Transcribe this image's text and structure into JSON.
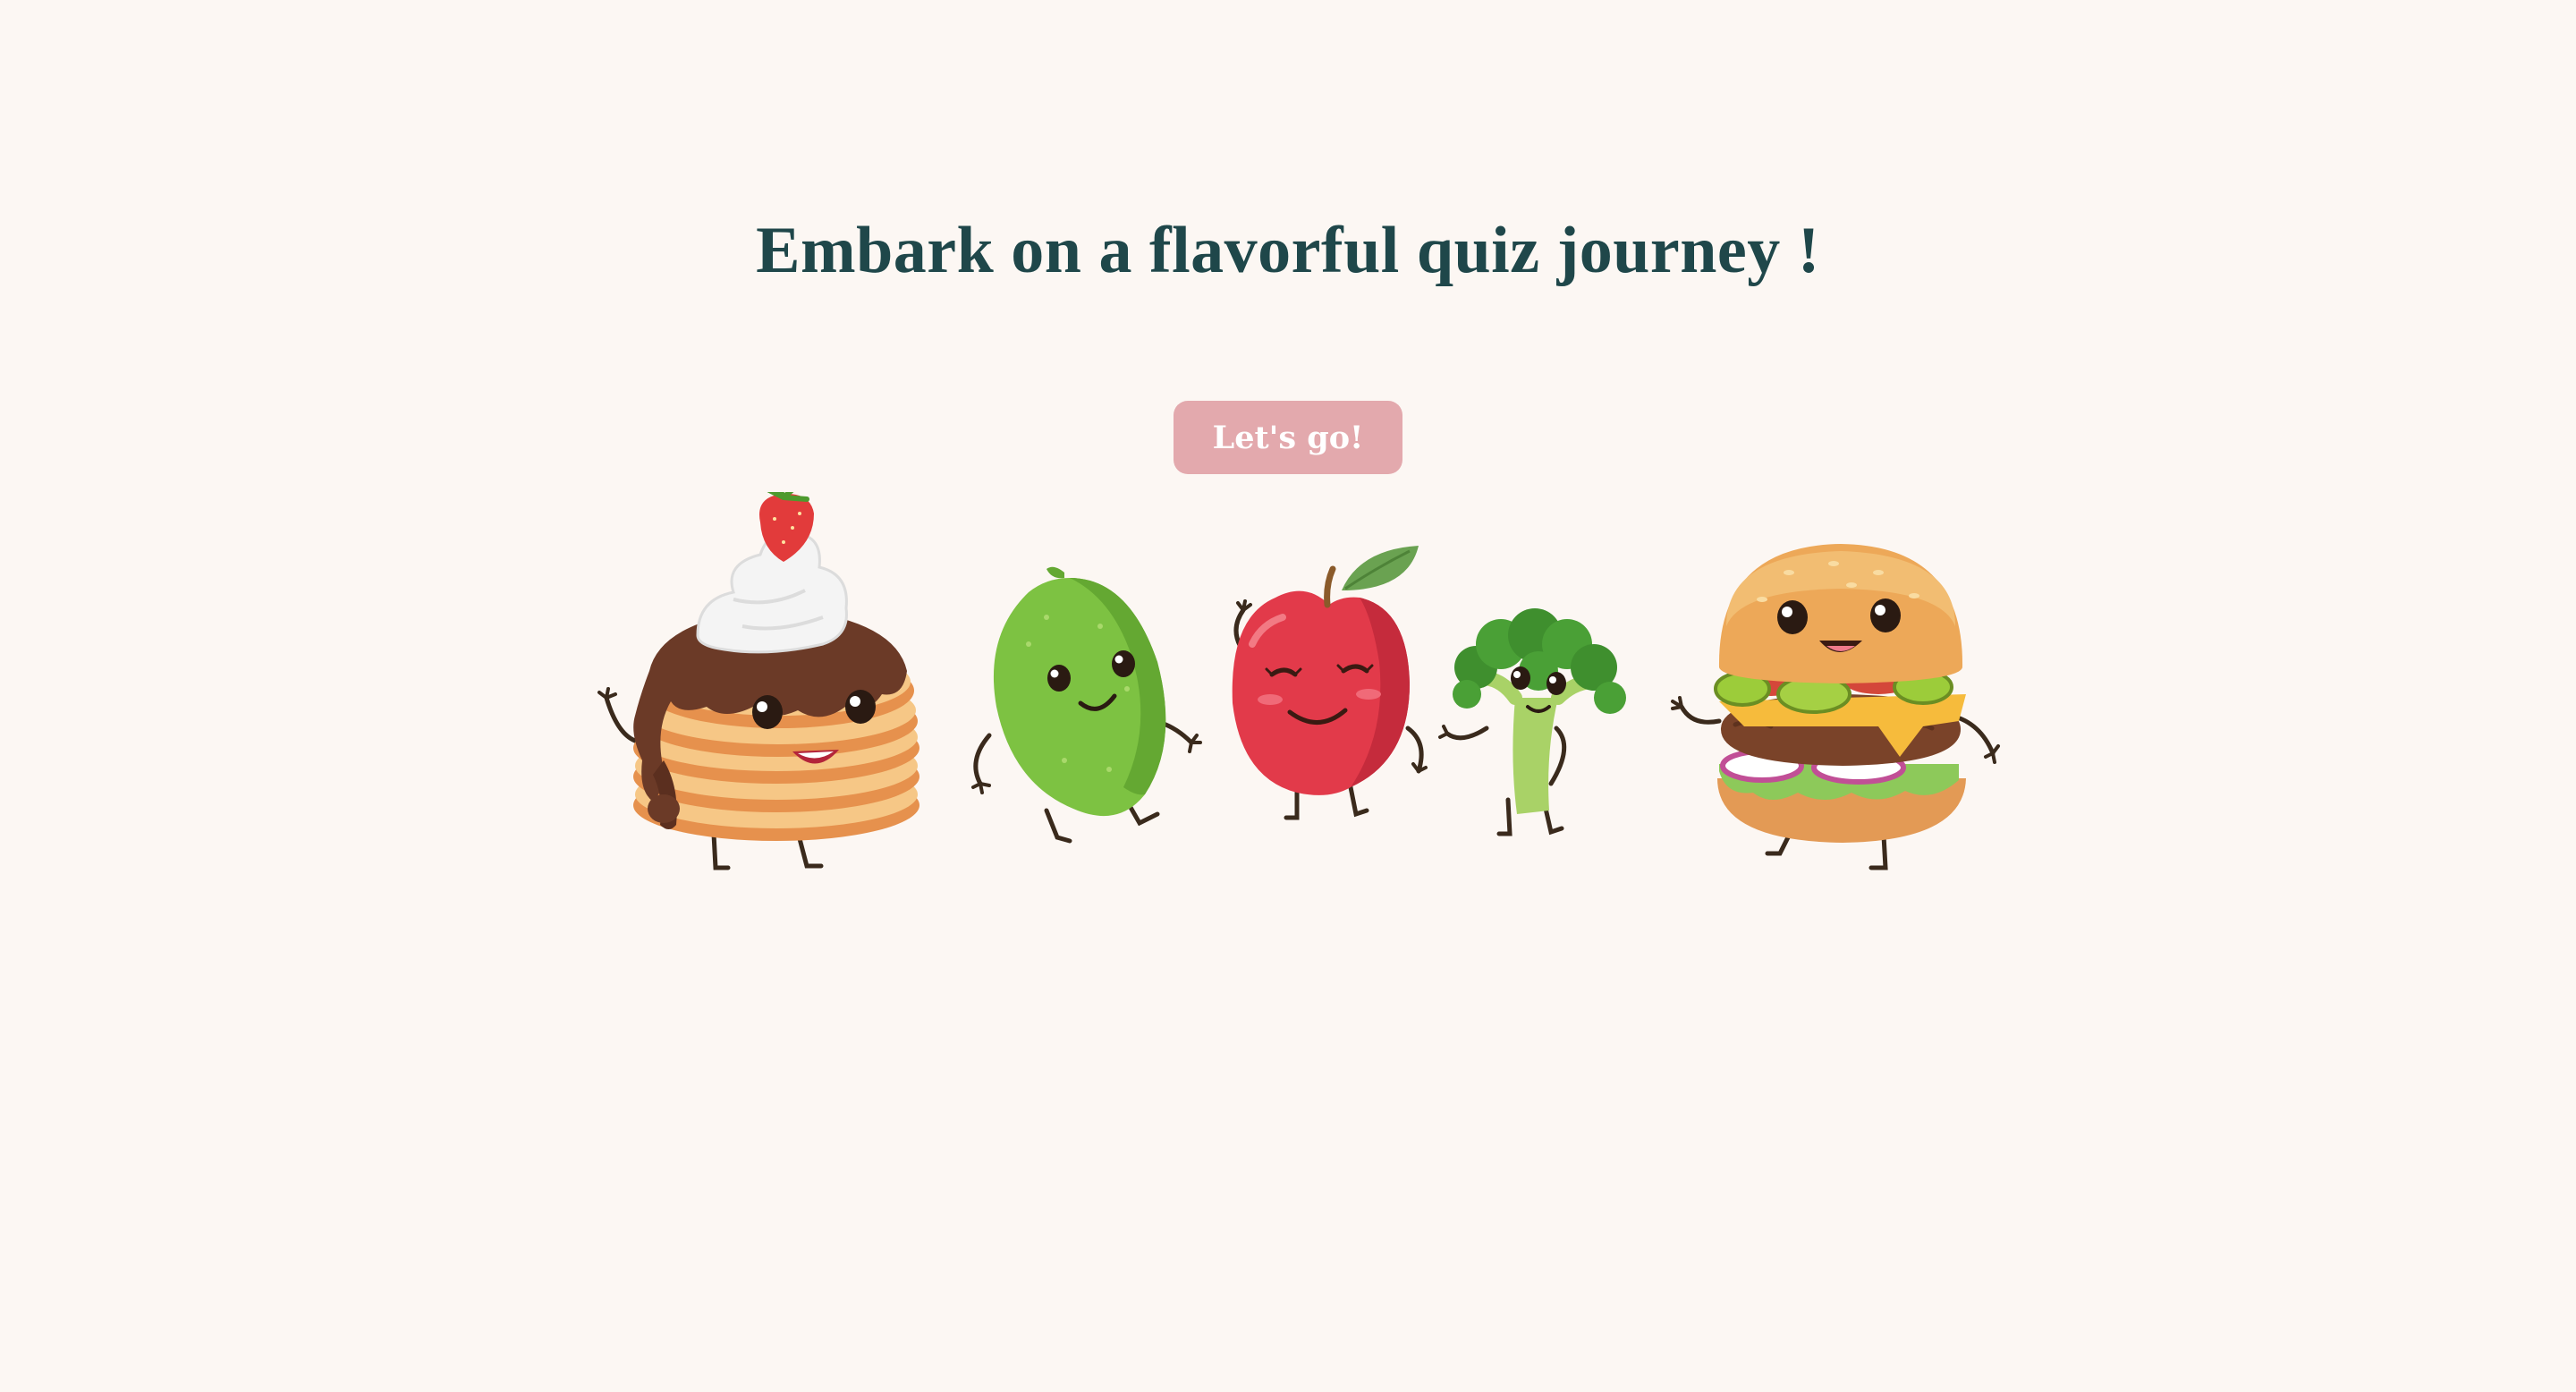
{
  "page": {
    "heading": "Embark on a flavorful quiz journey !",
    "start_button_label": "Let's go!"
  },
  "illustration": {
    "characters": [
      "pancake-stack",
      "lime",
      "apple",
      "broccoli",
      "burger"
    ]
  },
  "colors": {
    "background": "#fcf7f3",
    "heading": "#1f474a",
    "button": "#e3a9ad",
    "button_text": "#ffffff"
  }
}
